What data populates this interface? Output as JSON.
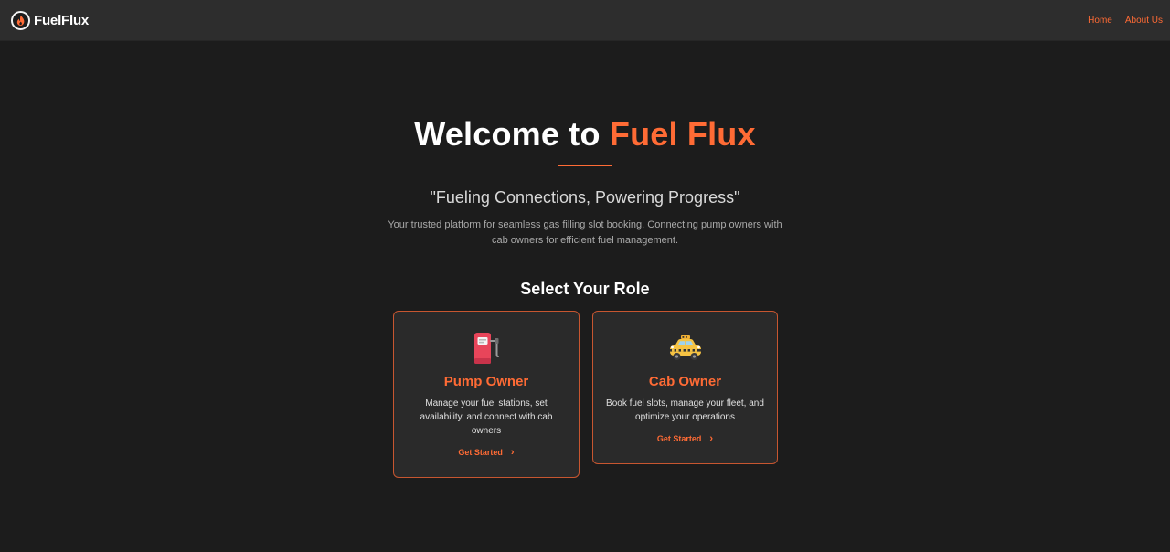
{
  "brand": {
    "name": "FuelFlux",
    "logo_icon": "flame-icon"
  },
  "nav": {
    "home": "Home",
    "about": "About Us"
  },
  "hero": {
    "title_prefix": "Welcome to",
    "title_accent": "Fuel Flux",
    "tagline": "\"Fueling Connections, Powering Progress\"",
    "description": "Your trusted platform for seamless gas filling slot booking. Connecting pump owners with cab owners for efficient fuel management.",
    "role_heading": "Select Your Role"
  },
  "cards": [
    {
      "icon": "fuel-pump-icon",
      "title": "Pump Owner",
      "text": "Manage your fuel stations, set availability, and connect with cab owners",
      "cta": "Get Started"
    },
    {
      "icon": "taxi-icon",
      "title": "Cab Owner",
      "text": "Book fuel slots, manage your fleet, and optimize your operations",
      "cta": "Get Started"
    }
  ],
  "colors": {
    "accent": "#ff6b35",
    "background": "#1c1c1c",
    "navbar": "#2d2d2d",
    "card": "#2a2a2a"
  }
}
